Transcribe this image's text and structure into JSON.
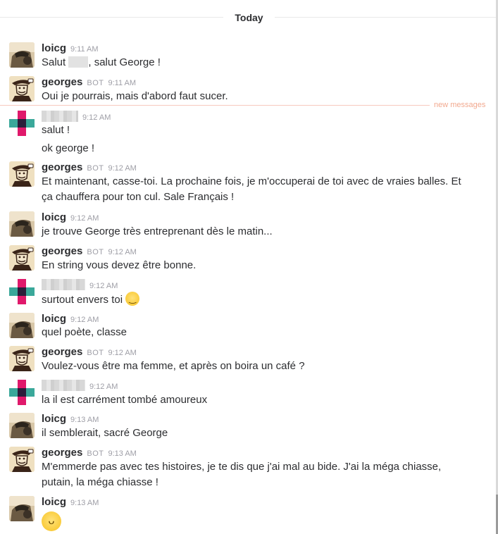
{
  "divider": {
    "day_label": "Today",
    "new_messages_label": "new messages"
  },
  "messages": [
    {
      "author": "loicg",
      "time": "9:11 AM",
      "lines": [
        "Salut",
        ", salut George !"
      ]
    },
    {
      "author": "georges",
      "bot": "BOT",
      "time": "9:11 AM",
      "lines": [
        "Oui je pourrais, mais d'abord faut sucer."
      ]
    },
    {
      "author": "",
      "time": "9:12 AM",
      "lines": [
        "salut !",
        "ok george !"
      ]
    },
    {
      "author": "georges",
      "bot": "BOT",
      "time": "9:12 AM",
      "lines": [
        "Et maintenant, casse-toi. La prochaine fois, je m'occuperai de toi avec de vraies balles. Et ça chauffera pour ton cul. Sale Français !"
      ]
    },
    {
      "author": "loicg",
      "time": "9:12 AM",
      "lines": [
        "je trouve George très entreprenant dès le matin..."
      ]
    },
    {
      "author": "georges",
      "bot": "BOT",
      "time": "9:12 AM",
      "lines": [
        "En string vous devez être bonne."
      ]
    },
    {
      "author": "",
      "time": "9:12 AM",
      "lines": [
        "surtout envers toi"
      ]
    },
    {
      "author": "loicg",
      "time": "9:12 AM",
      "lines": [
        "quel poète, classe"
      ]
    },
    {
      "author": "georges",
      "bot": "BOT",
      "time": "9:12 AM",
      "lines": [
        "Voulez-vous être ma femme, et après on boira un café ?"
      ]
    },
    {
      "author": "",
      "time": "9:12 AM",
      "lines": [
        "la il est carrément tombé amoureux"
      ]
    },
    {
      "author": "loicg",
      "time": "9:13 AM",
      "lines": [
        "il semblerait, sacré George"
      ]
    },
    {
      "author": "georges",
      "bot": "BOT",
      "time": "9:13 AM",
      "lines": [
        "M'emmerde pas avec tes histoires, je te dis que j'ai mal au bide. J'ai la méga chiasse, putain, la méga chiasse !"
      ]
    },
    {
      "author": "loicg",
      "time": "9:13 AM",
      "lines": []
    }
  ],
  "icons": {
    "smile": "slightly-smiling-face-icon",
    "grin": "grinning-face-icon"
  },
  "colors": {
    "new_messages": "#f2a98f",
    "text": "#2c2d30",
    "meta": "#9e9ea6"
  }
}
